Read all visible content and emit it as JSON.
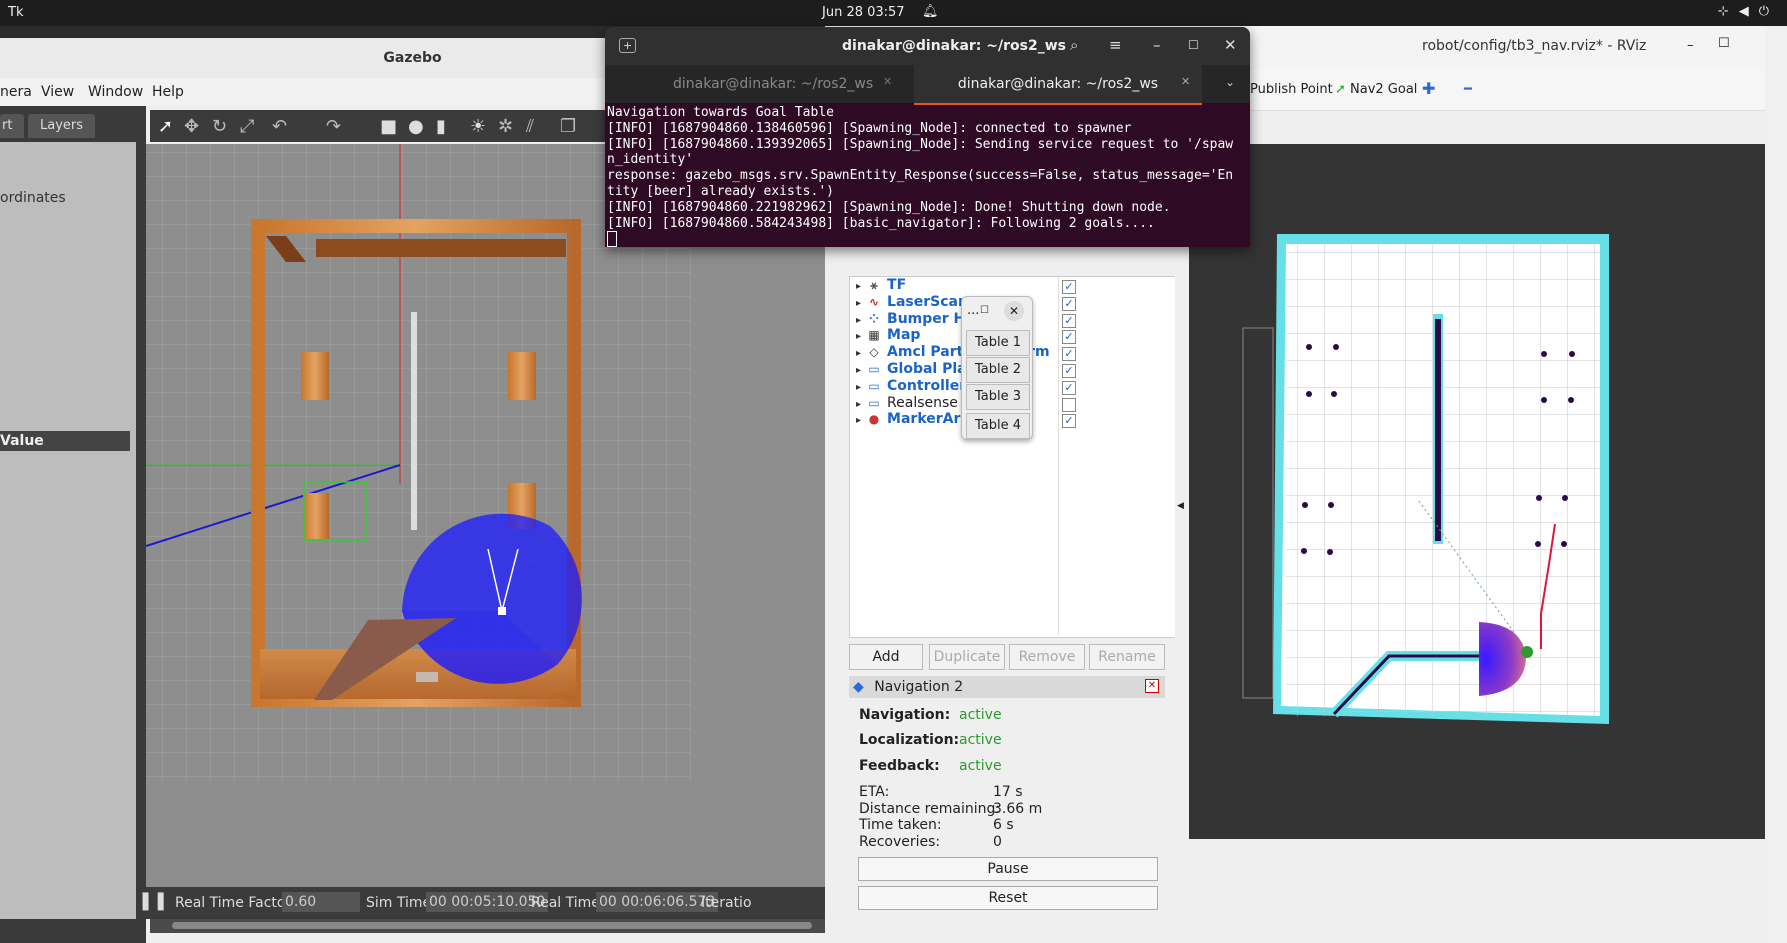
{
  "topbar": {
    "app": "Tk",
    "clock": "Jun 28  03:57"
  },
  "gazebo": {
    "title": "Gazebo",
    "menu": [
      "nera",
      "View",
      "Window",
      "Help"
    ],
    "tabs": [
      "rt",
      "Layers"
    ],
    "coords_label": "ordinates",
    "value_label": "Value",
    "status": {
      "rtf_label": "Real Time Factor:",
      "rtf_value": "0.60",
      "sim_label": "Sim Time:",
      "sim_value": "00 00:05:10.050",
      "real_label": "Real Time:",
      "real_value": "00 00:06:06.573",
      "iter_label": "Iteratio"
    }
  },
  "terminal": {
    "title": "dinakar@dinakar: ~/ros2_ws",
    "tabs": [
      "dinakar@dinakar: ~/ros2_ws",
      "dinakar@dinakar: ~/ros2_ws"
    ],
    "lines": [
      "Navigation towards Goal Table",
      "[INFO] [1687904860.138460596] [Spawning_Node]: connected to spawner",
      "[INFO] [1687904860.139392065] [Spawning_Node]: Sending service request to '/spaw",
      "n_identity'",
      "response: gazebo_msgs.srv.SpawnEntity_Response(success=False, status_message='En",
      "tity [beer] already exists.')",
      "[INFO] [1687904860.221982962] [Spawning_Node]: Done! Shutting down node.",
      "[INFO] [1687904860.584243498] [basic_navigator]: Following 2 goals...."
    ]
  },
  "rviz": {
    "title": "robot/config/tb3_nav.rviz* - RViz",
    "tools": [
      "Publish Point",
      "Nav2 Goal"
    ],
    "displays": [
      {
        "name": "TF",
        "checked": true,
        "icon": "tf-icon"
      },
      {
        "name": "LaserScan",
        "checked": true,
        "icon": "laserscan-icon"
      },
      {
        "name": "Bumper Hit",
        "checked": true,
        "icon": "bumper-icon"
      },
      {
        "name": "Map",
        "checked": true,
        "icon": "map-icon"
      },
      {
        "name": "Amcl Particle Swarm",
        "checked": true,
        "icon": "particle-icon"
      },
      {
        "name": "Global Planner",
        "checked": true,
        "icon": "folder-icon"
      },
      {
        "name": "Controller",
        "checked": true,
        "icon": "folder-icon"
      },
      {
        "name": "Realsense",
        "checked": false,
        "icon": "folder-icon"
      },
      {
        "name": "MarkerArray",
        "checked": true,
        "icon": "marker-icon"
      }
    ],
    "buttons": [
      "Add",
      "Duplicate",
      "Remove",
      "Rename"
    ],
    "nav2": {
      "header": "Navigation 2",
      "navigation_label": "Navigation:",
      "navigation_value": "active",
      "localization_label": "Localization:",
      "localization_value": "active",
      "feedback_label": "Feedback:",
      "feedback_value": "active",
      "eta_label": "ETA:",
      "eta_value": "17 s",
      "dist_label": "Distance remaining:",
      "dist_value": "3.66 m",
      "time_label": "Time taken:",
      "time_value": "6 s",
      "rec_label": "Recoveries:",
      "rec_value": "0",
      "pause": "Pause",
      "reset": "Reset"
    }
  },
  "table_popup": {
    "title": "...",
    "buttons": [
      "Table 1",
      "Table 2",
      "Table 3",
      "Table 4"
    ]
  }
}
